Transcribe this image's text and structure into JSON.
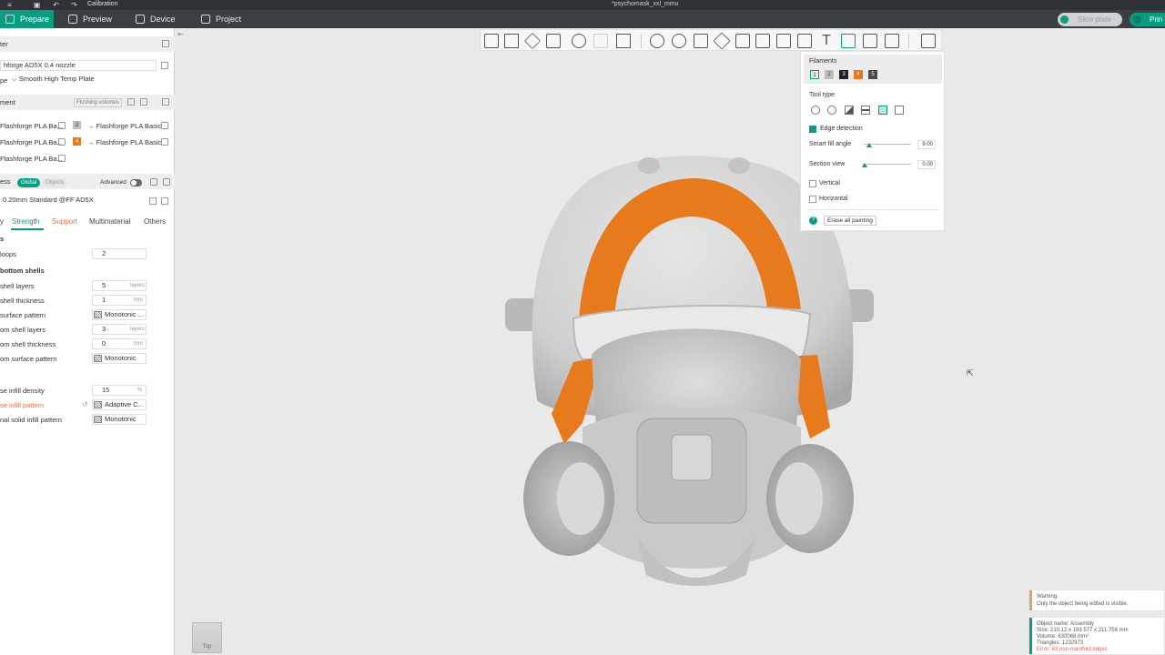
{
  "titlebar": {
    "menu_label": "Calibration",
    "window_title": "*psychomask_xxl_mmu"
  },
  "nav": {
    "tabs": [
      "Prepare",
      "Preview",
      "Device",
      "Project"
    ],
    "active_tab": 0,
    "slice_label": "Slice plate",
    "print_label": "Prin"
  },
  "left": {
    "printer": {
      "section": "ter",
      "printer": "hforge AD5X 0.4 nozzle",
      "plate_prefix": "pe",
      "plate": "Smooth High Temp Plate"
    },
    "filament": {
      "section": "ment",
      "flushing": "Flushing volumes",
      "rows": [
        {
          "left": "Flashforge PLA Ba...",
          "num": "2",
          "right": "Flashforge PLA Basic"
        },
        {
          "left": "Flashforge PLA Ba...",
          "num": "4",
          "right": "Flashforge PLA Basic"
        },
        {
          "left": "Flashforge PLA Ba...",
          "num": "",
          "right": ""
        }
      ]
    },
    "process": {
      "section": "ess",
      "global": "Global",
      "objects": "Objects",
      "advanced": "Advanced",
      "preset": "0.20mm Standard @FF AD5X",
      "tabs": [
        "y",
        "Strength",
        "Support",
        "Multimaterial",
        "Others"
      ]
    },
    "params": {
      "walls_header": "s",
      "wall_loops_label": "loops",
      "wall_loops": "2",
      "shells_header": "bottom shells",
      "top_layers_label": "shell layers",
      "top_layers": "5",
      "top_thick_label": "shell thickness",
      "top_thick": "1",
      "top_pattern_label": "surface pattern",
      "top_pattern": "Monotonic ...",
      "bot_layers_label": "om shell layers",
      "bot_layers": "3",
      "bot_thick_label": "om shell thickness",
      "bot_thick": "0",
      "bot_pattern_label": "om surface pattern",
      "bot_pattern": "Monotonic",
      "infill_header": "",
      "density_label": "se infill density",
      "density": "15",
      "infill_pattern_label": "se infill pattern",
      "infill_pattern": "Adaptive C...",
      "solid_pattern_label": "nal solid infill pattern",
      "solid_pattern": "Monotonic",
      "unit_layers": "layers",
      "unit_mm": "mm",
      "unit_pct": "%"
    }
  },
  "paint_panel": {
    "filaments_label": "Filaments",
    "swatches": [
      {
        "n": "1",
        "color": "#e9e9e9"
      },
      {
        "n": "2",
        "color": "#bdbdbd"
      },
      {
        "n": "3",
        "color": "#222222"
      },
      {
        "n": "4",
        "color": "#e87a1e"
      },
      {
        "n": "5",
        "color": "#4a4a4a"
      }
    ],
    "tool_type_label": "Tool type",
    "edge_detection": "Edge detection",
    "smart_fill_label": "Smart fill angle",
    "smart_fill_value": "9.00",
    "section_view_label": "Section view",
    "section_view_value": "0.00",
    "vertical": "Vertical",
    "horizontal": "Horizontal",
    "erase_all": "Erase all painting"
  },
  "notifications": {
    "warning_title": "Warning:",
    "warning_text": "Only the object being edited is visible.",
    "obj_name": "Object name: Assembly",
    "size": "Size: 210.12 x 193.577 x 211.756 mm",
    "volume": "Volume: 630068 mm³",
    "triangles": "Triangles: 1232973",
    "error": "Error: 63 non-manifold edges"
  },
  "view": {
    "navcube_top": "Top"
  },
  "colors": {
    "accent": "#0a9c7f",
    "paint_orange": "#e87a1e",
    "model_grey": "#d4d4d4"
  }
}
